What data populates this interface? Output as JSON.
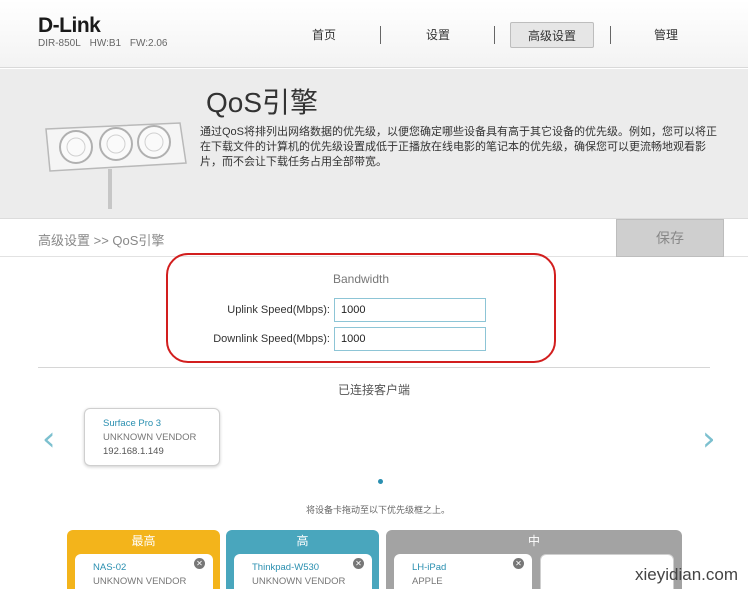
{
  "brand": {
    "logo": "D-Link",
    "model": "DIR-850L",
    "hw": "HW:B1",
    "fw": "FW:2.06"
  },
  "nav": {
    "home": "首页",
    "settings": "设置",
    "advanced": "高级设置",
    "manage": "管理"
  },
  "hero": {
    "title": "QoS引擎",
    "description": "通过QoS将排列出网络数据的优先级，以便您确定哪些设备具有高于其它设备的优先级。例如，您可以将正在下载文件的计算机的优先级设置成低于正播放在线电影的笔记本的优先级，确保您可以更流畅地观看影片，而不会让下载任务占用全部带宽。"
  },
  "breadcrumb": "高级设置 >> QoS引擎",
  "save_label": "保存",
  "bandwidth": {
    "title": "Bandwidth",
    "uplink_label": "Uplink Speed(Mbps):",
    "uplink_value": "1000",
    "downlink_label": "Downlink Speed(Mbps):",
    "downlink_value": "1000"
  },
  "clients": {
    "title": "已连接客户端",
    "items": [
      {
        "name": "Surface Pro 3",
        "vendor": "UNKNOWN VENDOR",
        "ip": "192.168.1.149"
      }
    ],
    "drag_hint": "将设备卡拖动至以下优先级框之上。"
  },
  "priorities": {
    "highest": {
      "label": "最高",
      "device": "NAS-02",
      "vendor": "UNKNOWN VENDOR"
    },
    "high": {
      "label": "高",
      "device": "Thinkpad-W530",
      "vendor": "UNKNOWN VENDOR"
    },
    "medium": {
      "label": "中",
      "device": "LH-iPad",
      "vendor": "APPLE"
    }
  },
  "watermark": "xieyidian.com",
  "colors": {
    "accent": "#2a8fb0",
    "highlight": "#d21e1e",
    "prio_highest": "#f3b41b",
    "prio_high": "#49a6bd",
    "prio_medium": "#a3a3a3"
  }
}
